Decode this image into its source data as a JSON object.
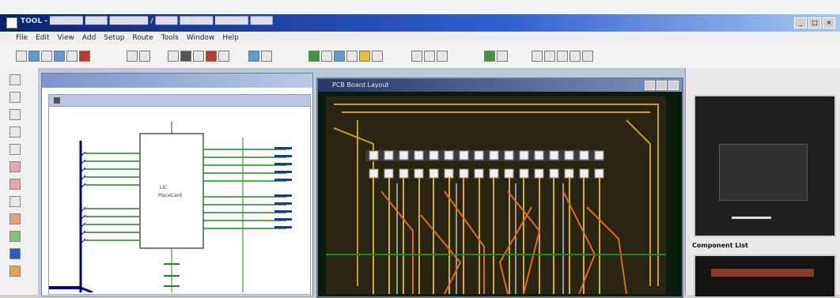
{
  "window": {
    "title": "TOOL - ██████ ████ ███████ / ████ ██████ ██████ ████",
    "buttons": [
      "_",
      "□",
      "×"
    ]
  },
  "menus": [
    "File",
    "Edit",
    "View",
    "Add",
    "Setup",
    "Route",
    "Tools",
    "Window",
    "Help"
  ],
  "pcb_window": {
    "title": "PCB Board Layout"
  },
  "schematic": {
    "component_label": "LIC\nPlaceCard",
    "left_pins": 10,
    "right_net_labels": [
      "",
      "",
      "",
      "",
      "",
      "",
      "",
      "",
      ""
    ]
  },
  "right_panel": {
    "label": "Component List"
  }
}
